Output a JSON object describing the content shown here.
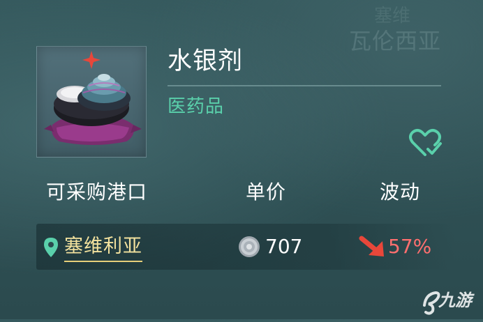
{
  "item": {
    "name": "水银剂",
    "category": "医药品",
    "icon": "mercury-jar-on-cushion"
  },
  "background": {
    "faded_text_main": "瓦伦西亚",
    "faded_text_top": "塞维"
  },
  "table": {
    "headers": {
      "port": "可采购港口",
      "price": "单价",
      "change": "波动"
    },
    "rows": [
      {
        "port": "塞维利亚",
        "price": "707",
        "change": "57%",
        "trend": "down"
      }
    ]
  },
  "colors": {
    "category": "#5ad0ab",
    "port_link": "#f3e29e",
    "change_down": "#ff6f6f",
    "favorite": "#5ad0ab"
  },
  "icons": {
    "favorite": "heart-check-icon",
    "location": "location-pin-icon",
    "currency": "silver-coin-icon",
    "trend": "trend-down-arrow-icon"
  },
  "watermark": {
    "text": "九游"
  }
}
